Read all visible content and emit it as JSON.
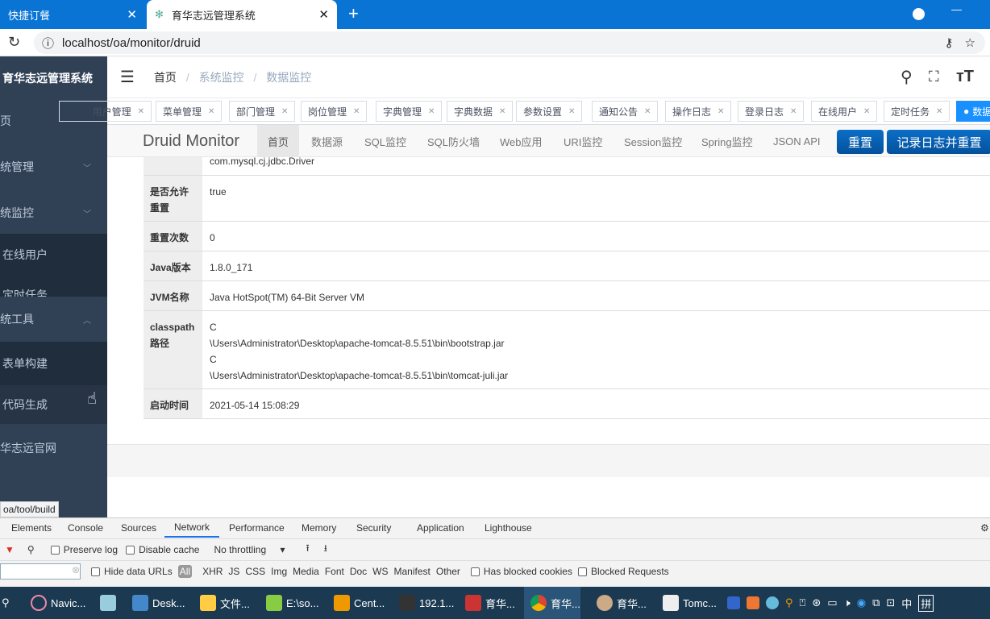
{
  "browser": {
    "tabs": [
      {
        "label": "快捷订餐"
      },
      {
        "label": "育华志远管理系统"
      }
    ],
    "url": "localhost/oa/monitor/druid"
  },
  "sidebar": {
    "title": "育华志远管理系统",
    "items": [
      {
        "label": "首页"
      },
      {
        "label": "系统管理"
      },
      {
        "label": "系统监控"
      },
      {
        "label": "在线用户"
      },
      {
        "label": "定时任务"
      },
      {
        "label": "系统工具"
      },
      {
        "label": "表单构建"
      },
      {
        "label": "代码生成"
      },
      {
        "label": "育华志远官网"
      }
    ]
  },
  "breadcrumb": [
    "首页",
    "系统监控",
    "数据监控"
  ],
  "breadcrumb_sep": "/",
  "tags": [
    {
      "label": "用户管理"
    },
    {
      "label": "菜单管理"
    },
    {
      "label": "部门管理"
    },
    {
      "label": "岗位管理"
    },
    {
      "label": "字典管理"
    },
    {
      "label": "字典数据"
    },
    {
      "label": "参数设置"
    },
    {
      "label": "通知公告"
    },
    {
      "label": "操作日志"
    },
    {
      "label": "登录日志"
    },
    {
      "label": "在线用户"
    },
    {
      "label": "定时任务"
    },
    {
      "label": "数据监控",
      "active": true
    }
  ],
  "druid": {
    "brand": "Druid Monitor",
    "nav": [
      "首页",
      "数据源",
      "SQL监控",
      "SQL防火墙",
      "Web应用",
      "URI监控",
      "Session监控",
      "Spring监控",
      "JSON API"
    ],
    "reset": "重置",
    "log_reset": "记录日志并重置"
  },
  "table": [
    {
      "label": "",
      "value": [
        "com.mysql.cj.jdbc.Driver"
      ]
    },
    {
      "label": "是否允许重置",
      "value": [
        "true"
      ]
    },
    {
      "label": "重置次数",
      "value": [
        "0"
      ]
    },
    {
      "label": "Java版本",
      "value": [
        "1.8.0_171"
      ]
    },
    {
      "label": "JVM名称",
      "value": [
        "Java HotSpot(TM) 64-Bit Server VM"
      ]
    },
    {
      "label": "classpath路径",
      "value": [
        "C",
        "\\Users\\Administrator\\Desktop\\apache-tomcat-8.5.51\\bin\\bootstrap.jar",
        "C",
        "\\Users\\Administrator\\Desktop\\apache-tomcat-8.5.51\\bin\\tomcat-juli.jar"
      ]
    },
    {
      "label": "启动时间",
      "value": [
        "2021-05-14 15:08:29"
      ]
    }
  ],
  "status_url": "oa/tool/build",
  "devtools": {
    "tabs": [
      "Elements",
      "Console",
      "Sources",
      "Network",
      "Performance",
      "Memory",
      "Security",
      "Application",
      "Lighthouse"
    ],
    "active": "Network",
    "preserve_log": "Preserve log",
    "disable_cache": "Disable cache",
    "throttling": "No throttling",
    "hide_data_urls": "Hide data URLs",
    "filters": [
      "All",
      "XHR",
      "JS",
      "CSS",
      "Img",
      "Media",
      "Font",
      "Doc",
      "WS",
      "Manifest",
      "Other"
    ],
    "blocked_cookies": "Has blocked cookies",
    "blocked_requests": "Blocked Requests"
  },
  "taskbar": [
    {
      "label": "Navic..."
    },
    {
      "label": ""
    },
    {
      "label": "Desk..."
    },
    {
      "label": "文件..."
    },
    {
      "label": "E:\\so..."
    },
    {
      "label": "Cent..."
    },
    {
      "label": "192.1..."
    },
    {
      "label": "育华..."
    },
    {
      "label": "育华..."
    },
    {
      "label": "育华..."
    },
    {
      "label": "Tomc..."
    }
  ],
  "tray": {
    "ime": "中",
    "ime2": "拼"
  },
  "colors": {
    "chrome": "#0a74d4",
    "sidebar": "#304156",
    "active_tag": "#1890ff",
    "druid_btn": "#0b62b5"
  }
}
